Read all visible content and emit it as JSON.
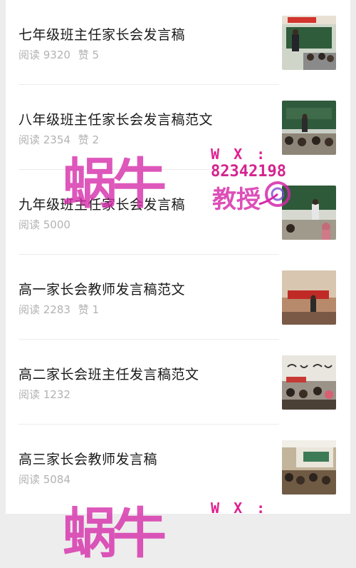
{
  "articles": [
    {
      "title": "七年级班主任家长会发言稿",
      "reads": "阅读 9320",
      "likes": "赞 5"
    },
    {
      "title": "八年级班主任家长会发言稿范文",
      "reads": "阅读 2354",
      "likes": "赞 2"
    },
    {
      "title": "九年级班主任家长会发言稿",
      "reads": "阅读 5000",
      "likes": ""
    },
    {
      "title": "高一家长会教师发言稿范文",
      "reads": "阅读 2283",
      "likes": "赞 1"
    },
    {
      "title": "高二家长会班主任发言稿范文",
      "reads": "阅读 1232",
      "likes": ""
    },
    {
      "title": "高三家长会教师发言稿",
      "reads": "阅读 5084",
      "likes": ""
    }
  ],
  "watermark": {
    "logo_text": "蜗牛",
    "wx_label": "W X :",
    "wx_number": "82342198",
    "subtitle": "教授",
    "brand_color": "#d528a8"
  },
  "thumb_icons": [
    "classroom-photo",
    "classroom-photo",
    "classroom-photo",
    "meeting-photo",
    "classroom-photo",
    "meeting-photo"
  ]
}
